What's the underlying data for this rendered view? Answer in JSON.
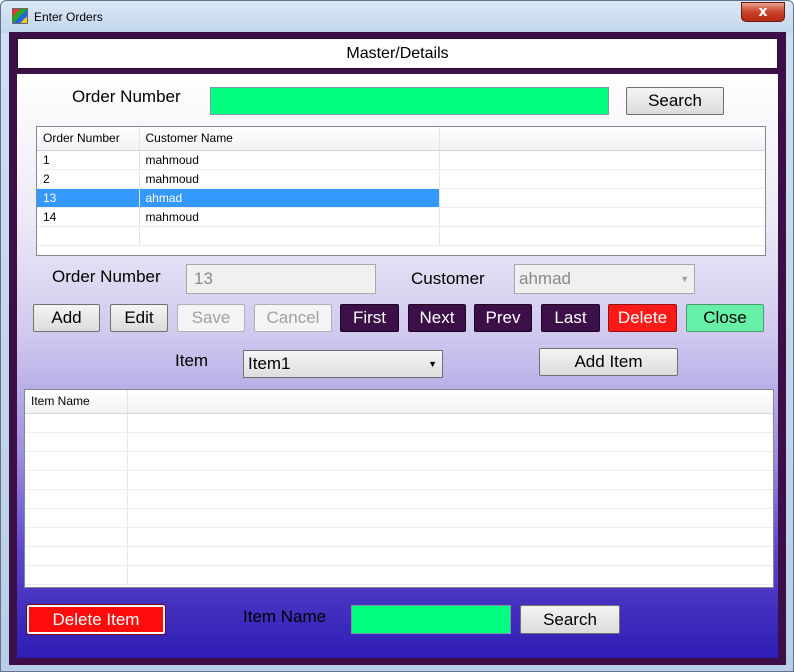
{
  "window": {
    "title": "Enter Orders",
    "close_glyph": "x"
  },
  "master_title": "Master/Details",
  "search_top": {
    "label": "Order Number",
    "value": "",
    "button": "Search"
  },
  "orders_grid": {
    "columns": [
      "Order Number",
      "Customer Name"
    ],
    "rows": [
      {
        "order": "1",
        "customer": "mahmoud"
      },
      {
        "order": "2",
        "customer": "mahmoud"
      },
      {
        "order": "13",
        "customer": "ahmad",
        "selected": true
      },
      {
        "order": "14",
        "customer": "mahmoud"
      }
    ]
  },
  "details": {
    "order_label": "Order Number",
    "order_value": "13",
    "customer_label": "Customer",
    "customer_value": "ahmad"
  },
  "actions": {
    "add": "Add",
    "edit": "Edit",
    "save": "Save",
    "cancel": "Cancel",
    "first": "First",
    "next": "Next",
    "prev": "Prev",
    "last": "Last",
    "delete": "Delete",
    "close": "Close"
  },
  "item_picker": {
    "label": "Item",
    "selected": "Item1",
    "add_button": "Add Item"
  },
  "items_grid": {
    "columns": [
      "Item Name"
    ],
    "rows": []
  },
  "bottom": {
    "delete_item": "Delete Item",
    "item_name_label": "Item Name",
    "item_name_value": "",
    "search": "Search"
  },
  "colors": {
    "accent_green": "#00ff7f",
    "dark_purple": "#3d0f48",
    "delete_red": "#ff1a1a",
    "close_green": "#66f0a8",
    "selection_blue": "#3399ff"
  }
}
